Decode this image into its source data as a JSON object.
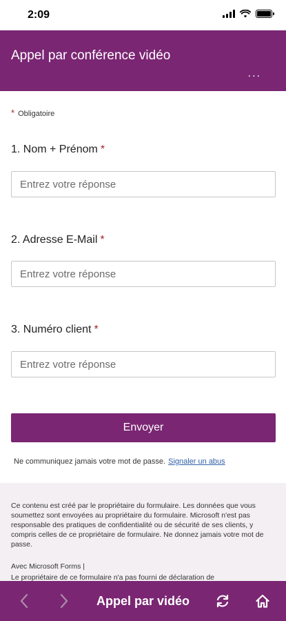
{
  "status_bar": {
    "time": "2:09"
  },
  "header": {
    "title": "Appel par conférence vidéo",
    "more_label": "..."
  },
  "form": {
    "required_star": "*",
    "required_label": "Obligatoire",
    "questions": [
      {
        "label": "1. Nom + Prénom",
        "required_mark": "*",
        "placeholder": "Entrez votre réponse",
        "value": ""
      },
      {
        "label": "2. Adresse E-Mail",
        "required_mark": "*",
        "placeholder": "Entrez votre réponse",
        "value": ""
      },
      {
        "label": "3. Numéro client",
        "required_mark": "*",
        "placeholder": "Entrez votre réponse",
        "value": ""
      }
    ],
    "submit_label": "Envoyer",
    "password_note": "Ne communiquez jamais votre mot de passe.",
    "report_link": "Signaler un abus"
  },
  "footer": {
    "text": "Ce contenu est créé par le propriétaire du formulaire. Les données que vous soumettez sont envoyées au propriétaire du formulaire. Microsoft n'est pas responsable des pratiques de confidentialité ou de sécurité de ses clients, y compris celles de ce propriétaire de formulaire. Ne donnez jamais votre mot de passe.",
    "brand": "Avec Microsoft Forms |",
    "disclaimer": "Le propriétaire de ce formulaire n'a pas fourni de déclaration de"
  },
  "bottom_bar": {
    "title": "Appel par vidéo",
    "icons": {
      "back": "chevron-left-icon",
      "forward": "chevron-right-icon",
      "refresh": "refresh-icon",
      "home": "home-icon"
    }
  },
  "colors": {
    "brand": "#7a2673",
    "required": "#a4262c",
    "link": "#2f5fa7",
    "footer_bg": "#f3eff2"
  }
}
